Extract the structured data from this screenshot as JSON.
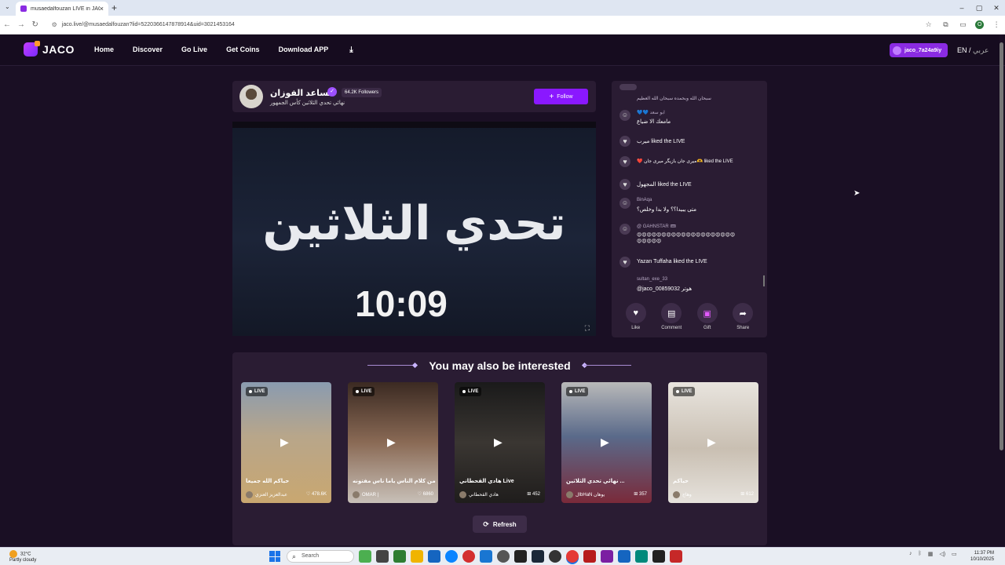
{
  "browser": {
    "tab_title": "musaedalfouzan LIVE in JACO",
    "url": "jaco.live/@musaedalfouzan?lid=5220366147878914&uid=3021453164"
  },
  "site": {
    "logo": "JACO",
    "nav": [
      "Home",
      "Discover",
      "Go Live",
      "Get Coins",
      "Download APP"
    ],
    "username": "jaco_7a24a9iy",
    "lang_en": "EN /",
    "lang_ar": "عربي"
  },
  "streamer": {
    "name": "مساعد الفوزان",
    "followers": "64.2K Followers",
    "title": "نهائي تحدي الثلاثين كأس الجمهور",
    "follow_label": "Follow"
  },
  "video": {
    "overlay_text": "تحدي الثلاثين",
    "timer": "10:09"
  },
  "chat": {
    "messages": [
      {
        "user": "",
        "text": "سبحان الله وبحمده سبحان الله العظيم"
      },
      {
        "user": "💙💙 ابو سعد",
        "text": "مامعك الا ضياع"
      },
      {
        "user": "",
        "text": "ميرب liked the LIVE"
      },
      {
        "user": "",
        "text": "❤️ ميرى جان بازيگر ميرى جان🫶 liked the LIVE"
      },
      {
        "user": "",
        "text": "المجهول liked the LIVE"
      },
      {
        "user": "BinAqa",
        "text": "متى يبيدا؟؟ ولا بدا وخلص؟"
      },
      {
        "user": "@ GAHNSTAR 🎟",
        "text": "😍😍😍😍😍😍😍😍😍😍😍😍😍😍😍😍😍😍😍😍😍😍😍😍😍"
      },
      {
        "user": "",
        "text": "Yazan Tuffaha liked the LIVE"
      },
      {
        "user": "sultan_exe_33",
        "text": "@jaco_00859032 هوتر"
      }
    ],
    "actions": [
      "Like",
      "Comment",
      "Gift",
      "Share"
    ]
  },
  "interested": {
    "heading": "You may also be interested",
    "cards": [
      {
        "badge": "LIVE",
        "title": "حياكم الله جميعا",
        "user": "عبدالعزيز العنزي",
        "count": "478.6K"
      },
      {
        "badge": "LIVE",
        "title": "من كلام الناس ياما ناس مفتونه",
        "user": "OMAR |",
        "count": "6860"
      },
      {
        "badge": "LIVE",
        "title": "هادي القحطاني Live",
        "user": "هادي القحطاني",
        "count": "452"
      },
      {
        "badge": "LIVE",
        "title": "نهائي تحدي الثلاثين ...",
        "user": "لIbHaN يوهان",
        "count": "357"
      },
      {
        "badge": "LIVE",
        "title": "حياكم",
        "user": "وهاج",
        "count": "612"
      }
    ],
    "refresh_label": "Refresh"
  },
  "taskbar": {
    "weather_temp": "32°C",
    "weather_desc": "Partly cloudy",
    "search_placeholder": "Search",
    "time": "11:37 PM",
    "date": "10/10/2025"
  }
}
